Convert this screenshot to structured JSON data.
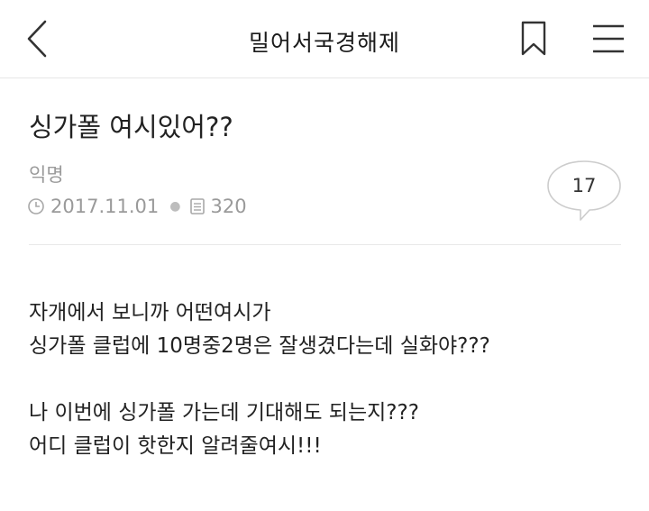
{
  "header": {
    "board_title": "밀어서국경해제",
    "back_icon": "chevron-left-icon",
    "bookmark_icon": "bookmark-icon",
    "menu_icon": "hamburger-menu-icon"
  },
  "post": {
    "title": "싱가폴 여시있어??",
    "author": "익명",
    "date": "2017.11.01",
    "views": "320",
    "comment_count": "17",
    "body_lines": [
      "자개에서 보니까 어떤여시가",
      "싱가폴 클럽에 10명중2명은 잘생겼다는데 실화야???",
      "",
      "나 이번에 싱가폴 가는데 기대해도 되는지???",
      "어디 클럽이 핫한지 알려줄여시!!!"
    ]
  },
  "colors": {
    "text_primary": "#222222",
    "text_muted": "#9a9a9a",
    "divider": "#e8e8e8",
    "background": "#ffffff"
  }
}
